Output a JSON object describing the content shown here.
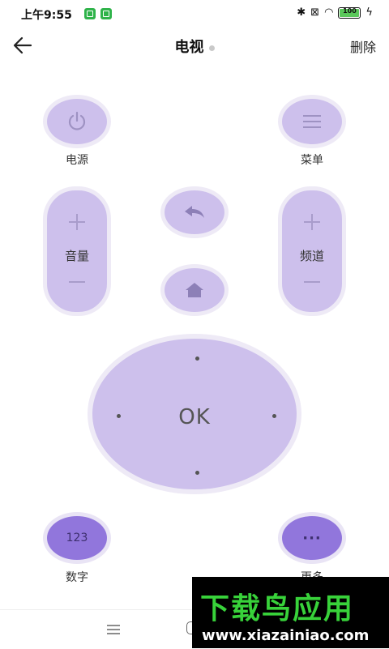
{
  "status_bar": {
    "time": "上午9:55",
    "battery": "100"
  },
  "header": {
    "title": "电视",
    "delete_label": "删除"
  },
  "remote": {
    "power_label": "电源",
    "menu_label": "菜单",
    "volume_label": "音量",
    "channel_label": "频道",
    "ok_label": "OK",
    "number_label": "数字",
    "number_button": "123",
    "more_label": "更多",
    "more_button": "···"
  },
  "watermark": {
    "brand": "下载鸟应用",
    "url": "www.xiazainiao.com"
  },
  "colors": {
    "button_fill": "#cdc0ec",
    "button_dark": "#9176dc",
    "button_ring": "#eeeaf6"
  }
}
